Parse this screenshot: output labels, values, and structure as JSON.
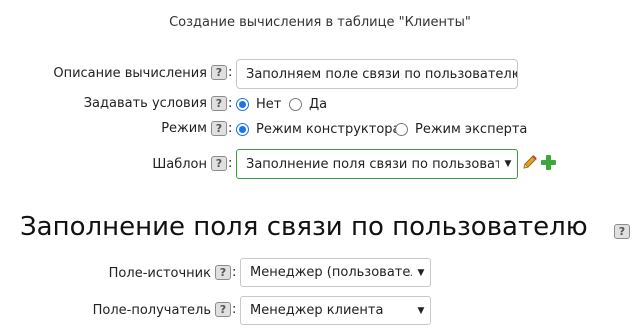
{
  "page_title": "Создание вычисления в таблице \"Клиенты\"",
  "description": {
    "label": "Описание вычисления",
    "help": "?",
    "value": "Заполняем поле связи по пользователю"
  },
  "conditions": {
    "label": "Задавать условия",
    "help": "?",
    "options": [
      "Нет",
      "Да"
    ],
    "selected": "Нет"
  },
  "mode": {
    "label": "Режим",
    "help": "?",
    "options": [
      "Режим конструктора",
      "Режим эксперта"
    ],
    "selected": "Режим конструктора"
  },
  "template": {
    "label": "Шаблон",
    "help": "?",
    "value": "Заполнение поля связи по пользователю",
    "edit_icon": "pencil-icon",
    "add_icon": "plus-icon",
    "accent": "#3b9e3b"
  },
  "section": {
    "title": "Заполнение поля связи по пользователю",
    "help": "?"
  },
  "source_field": {
    "label": "Поле-источник",
    "help": "?",
    "value": "Менеджер (пользователь)"
  },
  "target_field": {
    "label": "Поле-получатель",
    "help": "?",
    "value": "Менеджер клиента"
  },
  "colors": {
    "radio_accent": "#1a73e8",
    "plus": "#3aa83a",
    "pencil": "#e0a030"
  }
}
